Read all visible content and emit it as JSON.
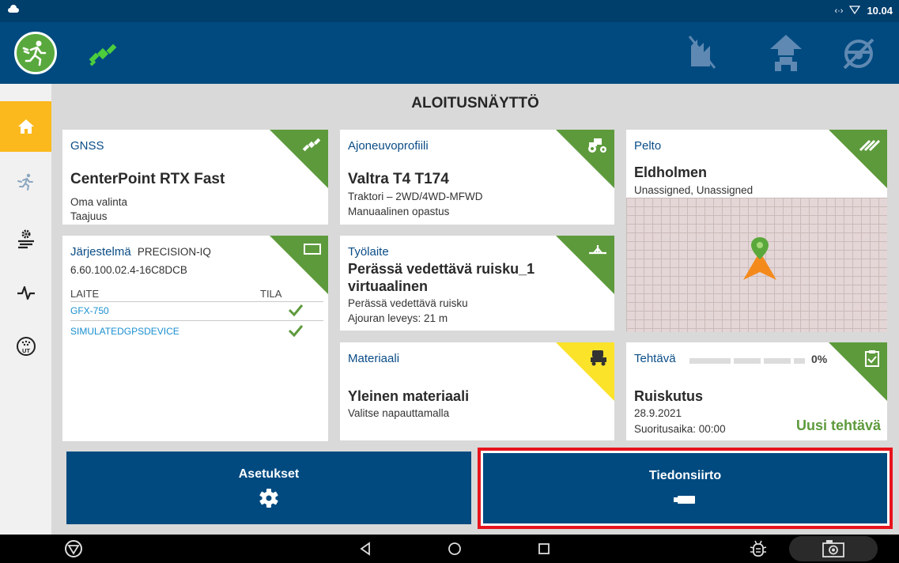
{
  "status_bar": {
    "time": "10.04",
    "signal_text": "‹·›"
  },
  "header": {
    "runner_icon": "runner-icon",
    "gnss_icon": "satellite-icon",
    "right_icons": [
      "disabled-field-icon",
      "vehicle-upload-icon",
      "disabled-steering-icon"
    ]
  },
  "sidebar": {
    "items": [
      {
        "icon": "home-icon",
        "active": true
      },
      {
        "icon": "runner-icon",
        "active": false
      },
      {
        "icon": "field-settings-icon",
        "active": false
      },
      {
        "icon": "pulse-icon",
        "active": false
      },
      {
        "icon": "ut-icon",
        "active": false
      }
    ]
  },
  "main": {
    "title": "ALOITUSNÄYTTÖ"
  },
  "cards": {
    "gnss": {
      "title": "GNSS",
      "value": "CenterPoint RTX Fast",
      "line1": "Oma valinta",
      "line2": "Taajuus"
    },
    "vehicle": {
      "title": "Ajoneuvoprofiili",
      "value": "Valtra T4 T174",
      "line1": "Traktori – 2WD/4WD-MFWD",
      "line2": "Manuaalinen opastus"
    },
    "field": {
      "title": "Pelto",
      "value": "Eldholmen",
      "line1": "Unassigned, Unassigned"
    },
    "system": {
      "title": "Järjestelmä",
      "name": "PRECISION-IQ",
      "version": "6.60.100.02.4-16C8DCB",
      "col_device": "LAITE",
      "col_status": "TILA",
      "devices": [
        "GFX-750",
        "SIMULATEDGPSDEVICE"
      ]
    },
    "implement": {
      "title": "Työlaite",
      "value_line1": "Perässä vedettävä ruisku_1",
      "value_line2": "virtuaalinen",
      "line1": "Perässä vedettävä ruisku",
      "line2": "Ajouran leveys: 21 m"
    },
    "material": {
      "title": "Materiaali",
      "value": "Yleinen materiaali",
      "line1": "Valitse napauttamalla"
    },
    "task": {
      "title": "Tehtävä",
      "progress_text": "0%",
      "progress": 0,
      "value": "Ruiskutus",
      "date": "28.9.2021",
      "duration": "Suoritusaika: 00:00",
      "new_task": "Uusi tehtävä"
    }
  },
  "buttons": {
    "settings": "Asetukset",
    "transfer": "Tiedonsiirto"
  },
  "colors": {
    "header_bg": "#004a80",
    "accent_green": "#5d9a3c",
    "accent_yellow": "#fbe32a",
    "sidebar_active": "#fbb91e",
    "highlight_red": "#e8141d"
  }
}
